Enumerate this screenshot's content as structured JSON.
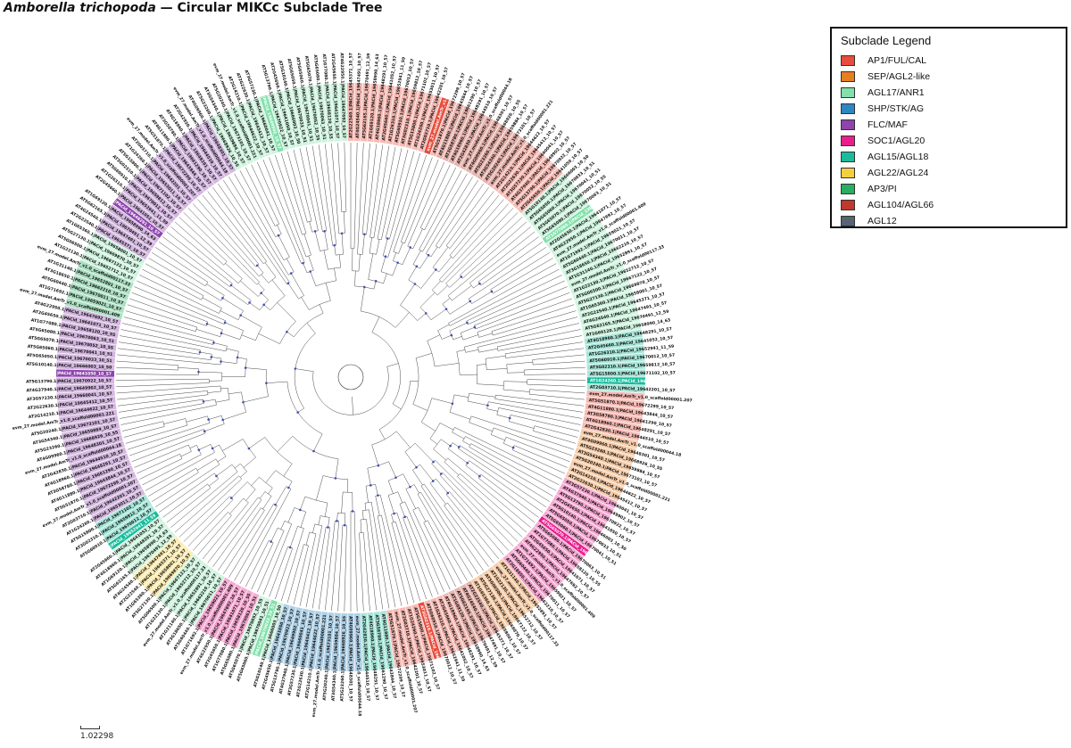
{
  "title": {
    "species": "Amborella trichopoda",
    "rest": " — Circular MIKCc Subclade Tree"
  },
  "legend": {
    "title": "Subclade Legend",
    "items": [
      {
        "label": "AP1/FUL/CAL",
        "color": "#e74c3c"
      },
      {
        "label": "SEP/AGL2-like",
        "color": "#e67e22"
      },
      {
        "label": "AGL17/ANR1",
        "color": "#82e0aa"
      },
      {
        "label": "SHP/STK/AG",
        "color": "#2e86c1"
      },
      {
        "label": "FLC/MAF",
        "color": "#8e44ad"
      },
      {
        "label": "SOC1/AGL20",
        "color": "#e91e8c"
      },
      {
        "label": "AGL15/AGL18",
        "color": "#1abc9c"
      },
      {
        "label": "AGL22/AGL24",
        "color": "#f4d03f"
      },
      {
        "label": "AP3/PI",
        "color": "#27ae60"
      },
      {
        "label": "AGL104/AGL66",
        "color": "#c0392b"
      },
      {
        "label": "AGL12",
        "color": "#566573"
      }
    ]
  },
  "scale_bar": {
    "label": "1.02298"
  },
  "tree": {
    "tips": [
      {
        "label": "AT2G22540.1|PACid_19645371_10_57",
        "clade": 2,
        "hl": 0
      },
      {
        "label": "AT4G24540.1|PACid_19647491_10_57",
        "clade": 6,
        "hl": 0
      },
      {
        "label": "AT5G62165.3|PACid_19670491_12_59",
        "clade": 6,
        "hl": 0
      },
      {
        "label": "AT1G69120.1|PACid_19658990_14_63",
        "clade": 5,
        "hl": 0
      },
      {
        "label": "AT4G18960.1|PACid_19648291_10_57",
        "clade": 0,
        "hl": 0
      },
      {
        "label": "AT2G45660.1|PACid_19641052_10_57",
        "clade": 5,
        "hl": 0
      },
      {
        "label": "AT1G26310.1|PACid_19652941_11_59",
        "clade": 0,
        "hl": 0
      },
      {
        "label": "AT5G60910.1|PACid_19670012_10_57",
        "clade": 0,
        "hl": 0
      },
      {
        "label": "AT3G02310.1|PACid_19659812_10_57",
        "clade": 1,
        "hl": 0
      },
      {
        "label": "AT5G15800.1|PACid_19671102_10_57",
        "clade": 1,
        "hl": 0
      },
      {
        "label": "AT1G24260.1|PACid_19653011_10_57",
        "clade": 1,
        "hl": 0
      },
      {
        "label": "AT2G03710.1|PACid_19642201_10_57",
        "clade": 1,
        "hl": 0
      },
      {
        "label": "evm_27.model.AmTr_v1.0_scaffold00001.207",
        "clade": 1,
        "hl": 1
      },
      {
        "label": "AT5G51870.1|PACid_19672299_10_57",
        "clade": 5,
        "hl": 0
      },
      {
        "label": "AT4G11880.1|PACid_19643844_10_57",
        "clade": 5,
        "hl": 0
      },
      {
        "label": "AT3G58780.1|PACid_19661290_10_57",
        "clade": 3,
        "hl": 0
      },
      {
        "label": "AT4G18960.1|PACid_19648291_10_57",
        "clade": 3,
        "hl": 0
      },
      {
        "label": "AT2G42830.1|PACid_19644510_10_57",
        "clade": 3,
        "hl": 0
      },
      {
        "label": "evm_27.model.AmTr_v1.0_scaffold00044.18",
        "clade": 3,
        "hl": 1
      },
      {
        "label": "AT4G09960.1|PACid_19648301_10_57",
        "clade": 3,
        "hl": 0
      },
      {
        "label": "AT5G23260.1|PACid_19668926_10_55",
        "clade": 8,
        "hl": 0
      },
      {
        "label": "AT3G54340.1|PACid_19659884_10_57",
        "clade": 8,
        "hl": 0
      },
      {
        "label": "AT5G20240.1|PACid_19673101_10_57",
        "clade": 8,
        "hl": 0
      },
      {
        "label": "evm_27.model.AmTr_v1.0_scaffold00001.221",
        "clade": 8,
        "hl": 1
      },
      {
        "label": "AT2G14210.1|PACid_19644622_10_57",
        "clade": 2,
        "hl": 0
      },
      {
        "label": "AT2G22630.1|PACid_19645412_10_57",
        "clade": 2,
        "hl": 0
      },
      {
        "label": "AT3G57230.1|PACid_19660041_10_57",
        "clade": 2,
        "hl": 0
      },
      {
        "label": "AT4G37940.1|PACid_19649902_10_57",
        "clade": 2,
        "hl": 0
      },
      {
        "label": "AT5G13790.1|PACid_19670922_10_57",
        "clade": 6,
        "hl": 0
      },
      {
        "label": "AT2G45650.1|PACid_19641050_10_57",
        "clade": 6,
        "hl": 0
      },
      {
        "label": "AT5G10140.1|PACid_19666003_10_50",
        "clade": 4,
        "hl": 0
      },
      {
        "label": "AT5G65050.1|PACid_19670033_10_51",
        "clade": 4,
        "hl": 0
      },
      {
        "label": "AT5G65060.1|PACid_19670041_10_51",
        "clade": 4,
        "hl": 0
      },
      {
        "label": "AT5G65070.1|PACid_19670052_10_55",
        "clade": 4,
        "hl": 0
      },
      {
        "label": "AT5G65080.1|PACid_19670063_10_51",
        "clade": 4,
        "hl": 0
      },
      {
        "label": "AT1G77080.1|PACid_19658120_10_55",
        "clade": 4,
        "hl": 0
      },
      {
        "label": "AT2G45650.1|PACid_19641071_10_57",
        "clade": 7,
        "hl": 0
      },
      {
        "label": "AT4G22950.1|PACid_19647692_10_57",
        "clade": 7,
        "hl": 0
      },
      {
        "label": "evm_27.model.AmTr_v1.0_scaffold00001.409",
        "clade": 7,
        "hl": 1
      },
      {
        "label": "AT1G71692.1|PACid_19659021_10_57",
        "clade": 10,
        "hl": 0
      },
      {
        "label": "AT5G60440.1|PACid_19670011_10_57",
        "clade": 10,
        "hl": 0
      },
      {
        "label": "AT3G18650.1|PACid_19662210_10_57",
        "clade": 9,
        "hl": 0
      },
      {
        "label": "AT1G31140.1|PACid_19652891_10_57",
        "clade": 9,
        "hl": 0
      },
      {
        "label": "evm_27.model.AmTr_v1.0_scaffold00117.33",
        "clade": 9,
        "hl": 1
      },
      {
        "label": "AT1G22130.1|PACid_19652712_10_57",
        "clade": 0,
        "hl": 0
      },
      {
        "label": "AT5G06500.1|PACid_19667122_10_57",
        "clade": 0,
        "hl": 0
      },
      {
        "label": "AT5G27130.1|PACid_19669870_10_57",
        "clade": 0,
        "hl": 0
      },
      {
        "label": "AT1G65360.1|PACid_19658001_10_57",
        "clade": 0,
        "hl": 0
      }
    ]
  }
}
